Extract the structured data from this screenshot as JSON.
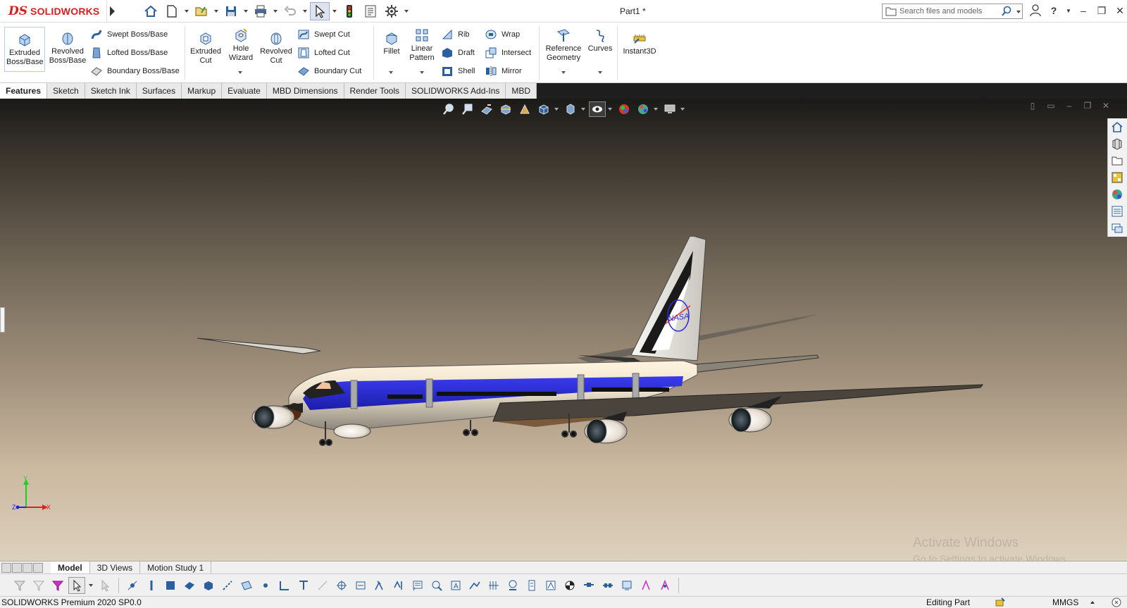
{
  "app": {
    "logo_ds": "DS",
    "logo_text": "SOLIDWORKS",
    "document_title": "Part1 *"
  },
  "search": {
    "placeholder": "Search files and models"
  },
  "ribbon": {
    "extruded_boss": "Extruded Boss/Base",
    "revolved_boss": "Revolved Boss/Base",
    "swept_boss": "Swept Boss/Base",
    "lofted_boss": "Lofted Boss/Base",
    "boundary_boss": "Boundary Boss/Base",
    "extruded_cut": "Extruded Cut",
    "hole_wizard": "Hole Wizard",
    "revolved_cut": "Revolved Cut",
    "swept_cut": "Swept Cut",
    "lofted_cut": "Lofted Cut",
    "boundary_cut": "Boundary Cut",
    "fillet": "Fillet",
    "linear_pattern": "Linear Pattern",
    "rib": "Rib",
    "draft": "Draft",
    "shell": "Shell",
    "wrap": "Wrap",
    "intersect": "Intersect",
    "mirror": "Mirror",
    "reference_geometry": "Reference Geometry",
    "curves": "Curves",
    "instant3d": "Instant3D"
  },
  "command_tabs": [
    "Features",
    "Sketch",
    "Sketch Ink",
    "Surfaces",
    "Markup",
    "Evaluate",
    "MBD Dimensions",
    "Render Tools",
    "SOLIDWORKS Add-Ins",
    "MBD"
  ],
  "viewport": {
    "triad": {
      "x": "X",
      "y": "Y",
      "z": "Z"
    },
    "model_livery_text": "NASA",
    "watermark_title": "Activate Windows",
    "watermark_sub": "Go to Settings to activate Windows."
  },
  "bottom_tabs": [
    "Model",
    "3D Views",
    "Motion Study 1"
  ],
  "status": {
    "product": "SOLIDWORKS Premium 2020 SP0.0",
    "mode": "Editing Part",
    "units": "MMGS"
  },
  "colors": {
    "brand_red": "#d81e1e",
    "livery_blue": "#2a2bd8",
    "viewport_top": "#1a1a18",
    "viewport_bottom": "#ddd0bd"
  }
}
